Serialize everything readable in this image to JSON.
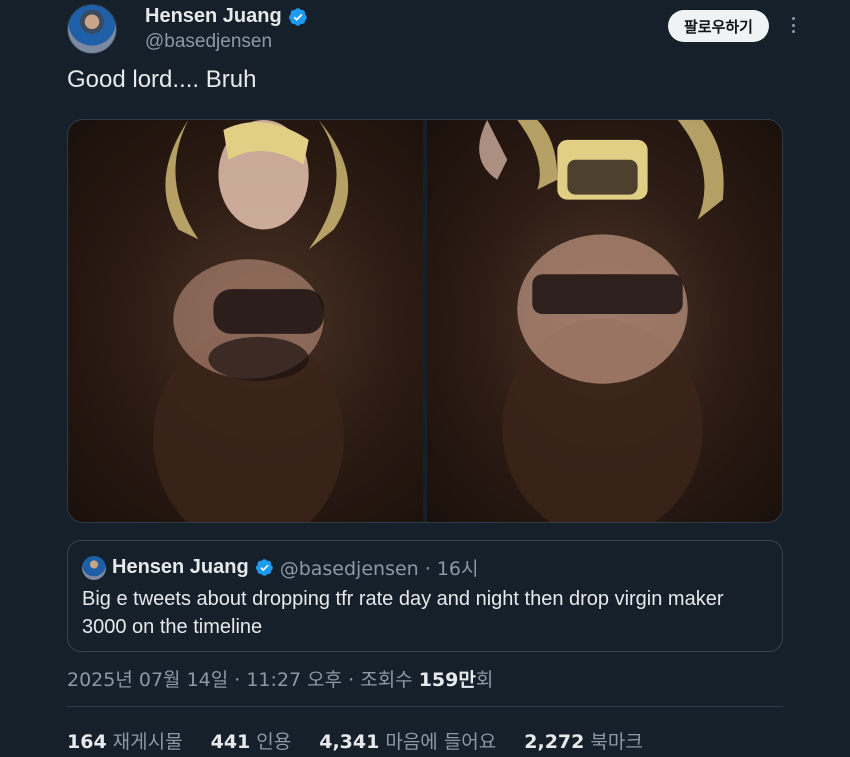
{
  "author": {
    "display_name": "Hensen Juang",
    "handle": "@basedjensen",
    "avatar": "user-avatar"
  },
  "follow_label": "팔로우하기",
  "tweet": {
    "text": "Good lord.... Bruh",
    "media_count": 2
  },
  "quote": {
    "display_name": "Hensen Juang",
    "handle_time": "@basedjensen · 16시",
    "text": "Big e tweets about dropping tfr rate day and night then drop virgin maker 3000 on the timeline"
  },
  "meta": {
    "date_time": "2025년 07월 14일 · 11:27 오후 · 조회수 ",
    "views": "159만",
    "views_suffix": "회"
  },
  "stats": [
    {
      "count": "164",
      "label": "재게시물"
    },
    {
      "count": "441",
      "label": "인용"
    },
    {
      "count": "4,341",
      "label": "마음에 들어요"
    },
    {
      "count": "2,272",
      "label": "북마크"
    }
  ],
  "colors": {
    "background": "#15202b",
    "verified": "#1d9bf0",
    "muted_text": "#8b98a5"
  }
}
